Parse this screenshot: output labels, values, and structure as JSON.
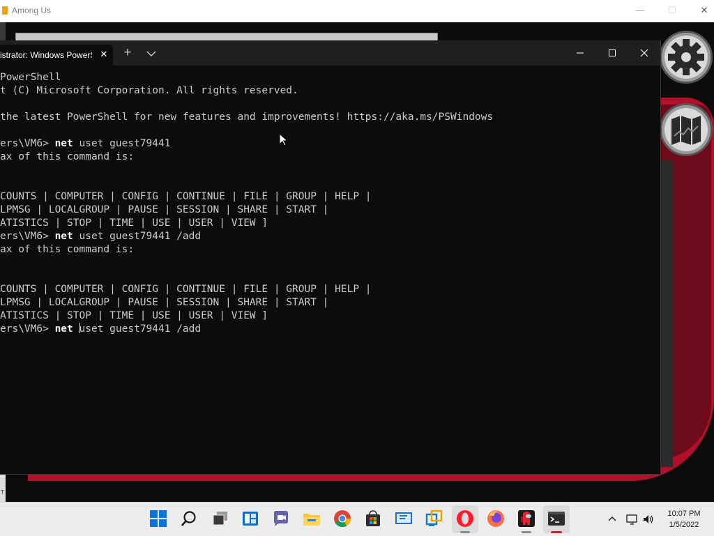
{
  "game_window": {
    "title": "Among Us",
    "controls": {
      "minimize": "—",
      "maximize": "☐",
      "close": "✕"
    },
    "side_buttons": [
      "settings-gear",
      "map"
    ],
    "bottom_left_label": "T"
  },
  "terminal": {
    "tab_title": "istrator: Windows PowerS",
    "tab_close": "✕",
    "new_tab": "+",
    "lines": [
      {
        "prefix": "PowerShell",
        "kw": "",
        "rest": ""
      },
      {
        "prefix": "t (C) Microsoft Corporation. All rights reserved.",
        "kw": "",
        "rest": ""
      },
      {
        "prefix": "",
        "kw": "",
        "rest": ""
      },
      {
        "prefix": "the latest PowerShell for new features and improvements! https://aka.ms/PSWindows",
        "kw": "",
        "rest": ""
      },
      {
        "prefix": "",
        "kw": "",
        "rest": ""
      },
      {
        "prefix": "ers\\VM6> ",
        "kw": "net",
        "rest": " uset guest79441"
      },
      {
        "prefix": "ax of this command is:",
        "kw": "",
        "rest": ""
      },
      {
        "prefix": "",
        "kw": "",
        "rest": ""
      },
      {
        "prefix": "",
        "kw": "",
        "rest": ""
      },
      {
        "prefix": "COUNTS | COMPUTER | CONFIG | CONTINUE | FILE | GROUP | HELP |",
        "kw": "",
        "rest": ""
      },
      {
        "prefix": "LPMSG | LOCALGROUP | PAUSE | SESSION | SHARE | START |",
        "kw": "",
        "rest": ""
      },
      {
        "prefix": "ATISTICS | STOP | TIME | USE | USER | VIEW ]",
        "kw": "",
        "rest": ""
      },
      {
        "prefix": "ers\\VM6> ",
        "kw": "net",
        "rest": " uset guest79441 /add"
      },
      {
        "prefix": "ax of this command is:",
        "kw": "",
        "rest": ""
      },
      {
        "prefix": "",
        "kw": "",
        "rest": ""
      },
      {
        "prefix": "",
        "kw": "",
        "rest": ""
      },
      {
        "prefix": "COUNTS | COMPUTER | CONFIG | CONTINUE | FILE | GROUP | HELP |",
        "kw": "",
        "rest": ""
      },
      {
        "prefix": "LPMSG | LOCALGROUP | PAUSE | SESSION | SHARE | START |",
        "kw": "",
        "rest": ""
      },
      {
        "prefix": "ATISTICS | STOP | TIME | USE | USER | VIEW ]",
        "kw": "",
        "rest": ""
      }
    ],
    "current_input": {
      "prompt": "ers\\VM6> ",
      "kw": "net",
      "before_cursor": " ",
      "after_cursor": "uset guest79441 /add"
    }
  },
  "taskbar": {
    "pinned": [
      "windows-start",
      "search",
      "task-view",
      "widgets",
      "teams-chat",
      "file-explorer",
      "chrome",
      "microsoft-store",
      "remote-desktop",
      "network-app",
      "opera",
      "firefox",
      "among-us",
      "windows-terminal"
    ],
    "clock_time": "10:07 PM",
    "clock_date": "1/5/2022"
  },
  "colors": {
    "terminal_bg": "#0c0c0c",
    "terminal_text": "#cccccc",
    "game_red": "#b0102a",
    "taskbar_bg": "#ececec"
  }
}
